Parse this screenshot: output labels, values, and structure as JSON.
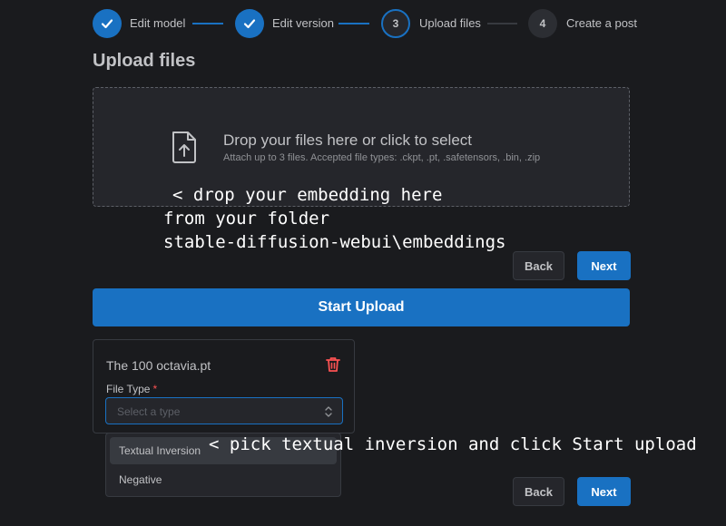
{
  "stepper": {
    "steps": [
      {
        "number": "1",
        "label": "Edit model",
        "state": "completed"
      },
      {
        "number": "2",
        "label": "Edit version",
        "state": "completed"
      },
      {
        "number": "3",
        "label": "Upload files",
        "state": "active"
      },
      {
        "number": "4",
        "label": "Create a post",
        "state": "pending"
      }
    ]
  },
  "page": {
    "title": "Upload files"
  },
  "dropzone": {
    "title": "Drop your files here or click to select",
    "subtitle": "Attach up to 3 files. Accepted file types: .ckpt, .pt, .safetensors, .bin, .zip",
    "icon": "file-upload-icon"
  },
  "annotations": {
    "drop_lines": [
      "< drop your embedding here",
      "from your folder",
      "stable-diffusion-webui\\embeddings"
    ],
    "pick_line": "< pick textual inversion and click Start upload"
  },
  "nav_top": {
    "back_label": "Back",
    "next_label": "Next"
  },
  "start_upload": {
    "label": "Start Upload"
  },
  "file_card": {
    "file_name": "The 100 octavia.pt",
    "delete_icon": "trash-icon",
    "file_type_label": "File Type",
    "required_mark": "*",
    "select_placeholder": "Select a type"
  },
  "dropdown": {
    "options": [
      "Textual Inversion",
      "Negative"
    ],
    "hovered": "Textual Inversion"
  },
  "nav_bottom": {
    "back_label": "Back",
    "next_label": "Next"
  },
  "colors": {
    "accent": "#1971c2",
    "background": "#1a1b1e",
    "danger": "#fa5252"
  }
}
